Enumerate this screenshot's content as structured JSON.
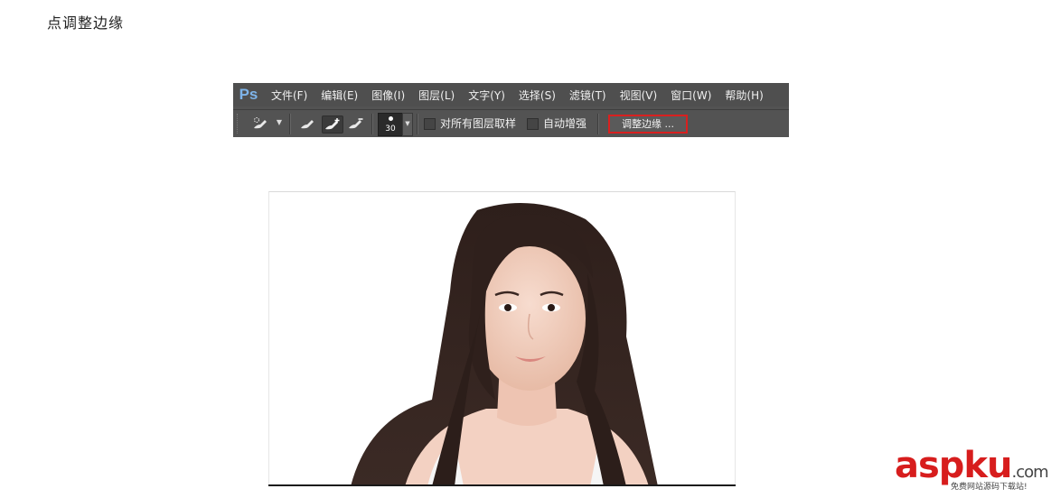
{
  "caption": "点调整边缘",
  "app": {
    "logo": "Ps",
    "menu": [
      "文件(F)",
      "编辑(E)",
      "图像(I)",
      "图层(L)",
      "文字(Y)",
      "选择(S)",
      "滤镜(T)",
      "视图(V)",
      "窗口(W)",
      "帮助(H)"
    ]
  },
  "toolbar": {
    "brush_size": "30",
    "sample_all_layers": {
      "label": "对所有图层取样",
      "checked": false
    },
    "auto_enhance": {
      "label": "自动增强",
      "checked": false
    },
    "refine_edge_label": "调整边缘 ..."
  },
  "colors": {
    "highlight": "#d9201f",
    "panel": "#535353",
    "logo": "#7eb4ea"
  },
  "watermark": {
    "main": "aspku",
    "suffix": ".com",
    "sub": "免费网站源码下载站!"
  }
}
